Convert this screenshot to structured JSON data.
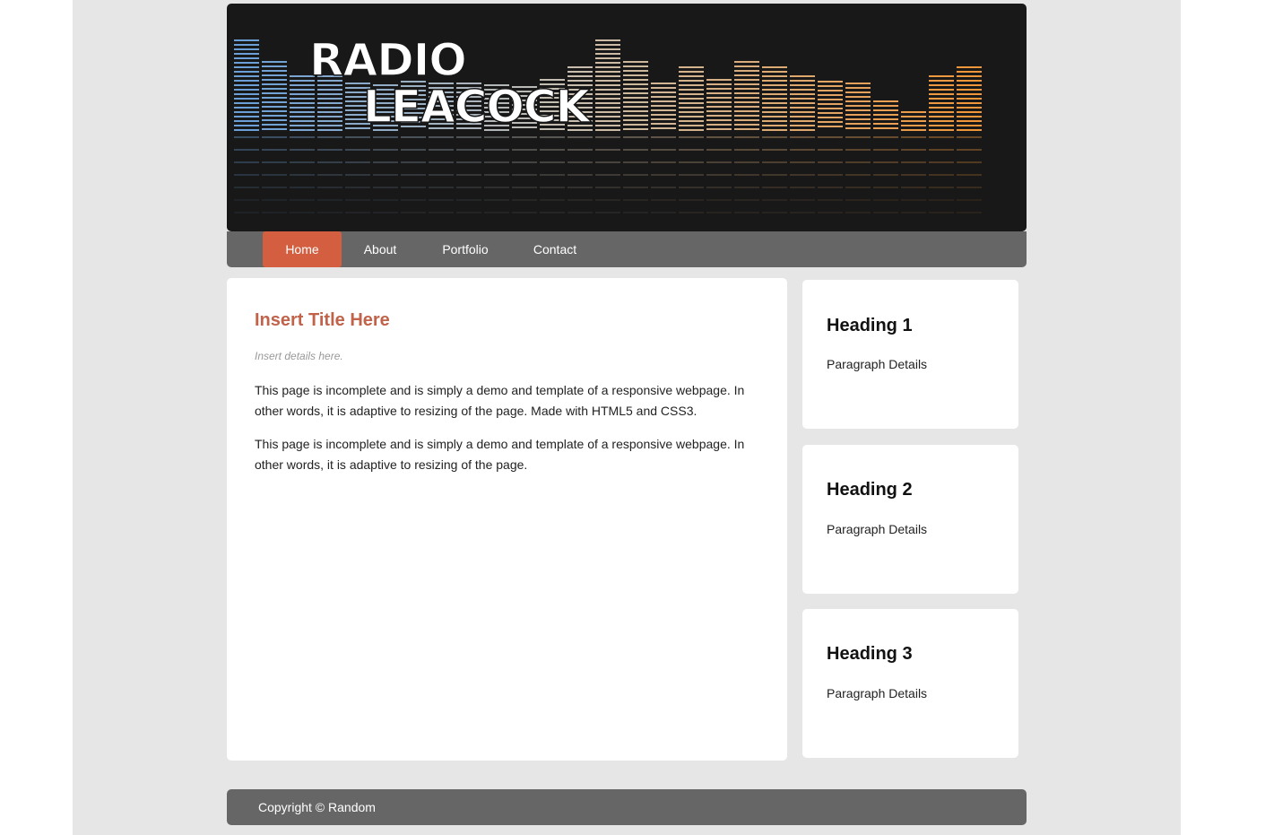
{
  "site": {
    "logo_line1": "RADIO",
    "logo_line2": "LEACOCK"
  },
  "nav": {
    "items": [
      {
        "label": "Home",
        "active": true
      },
      {
        "label": "About",
        "active": false
      },
      {
        "label": "Portfolio",
        "active": false
      },
      {
        "label": "Contact",
        "active": false
      }
    ]
  },
  "main": {
    "title": "Insert Title Here",
    "meta": "Insert details here.",
    "paragraphs": [
      "This page is incomplete and is simply a demo and template of a responsive webpage. In other words, it is adaptive to resizing of the page. Made with HTML5 and CSS3.",
      "This page is incomplete and is simply a demo and template of a responsive webpage. In other words, it is adaptive to resizing of the page."
    ]
  },
  "sidebar": {
    "cards": [
      {
        "heading": "Heading 1",
        "text": "Paragraph Details"
      },
      {
        "heading": "Heading 2",
        "text": "Paragraph Details"
      },
      {
        "heading": "Heading 3",
        "text": "Paragraph Details"
      }
    ]
  },
  "footer": {
    "text": "Copyright © Random"
  },
  "colors": {
    "accent": "#d35f40",
    "title": "#c0634a",
    "bar": "#666666",
    "banner_bg": "#181818",
    "eq_blue": "#6b9fd8",
    "eq_orange": "#f0963a"
  },
  "icons": [
    "equalizer-graphic"
  ]
}
